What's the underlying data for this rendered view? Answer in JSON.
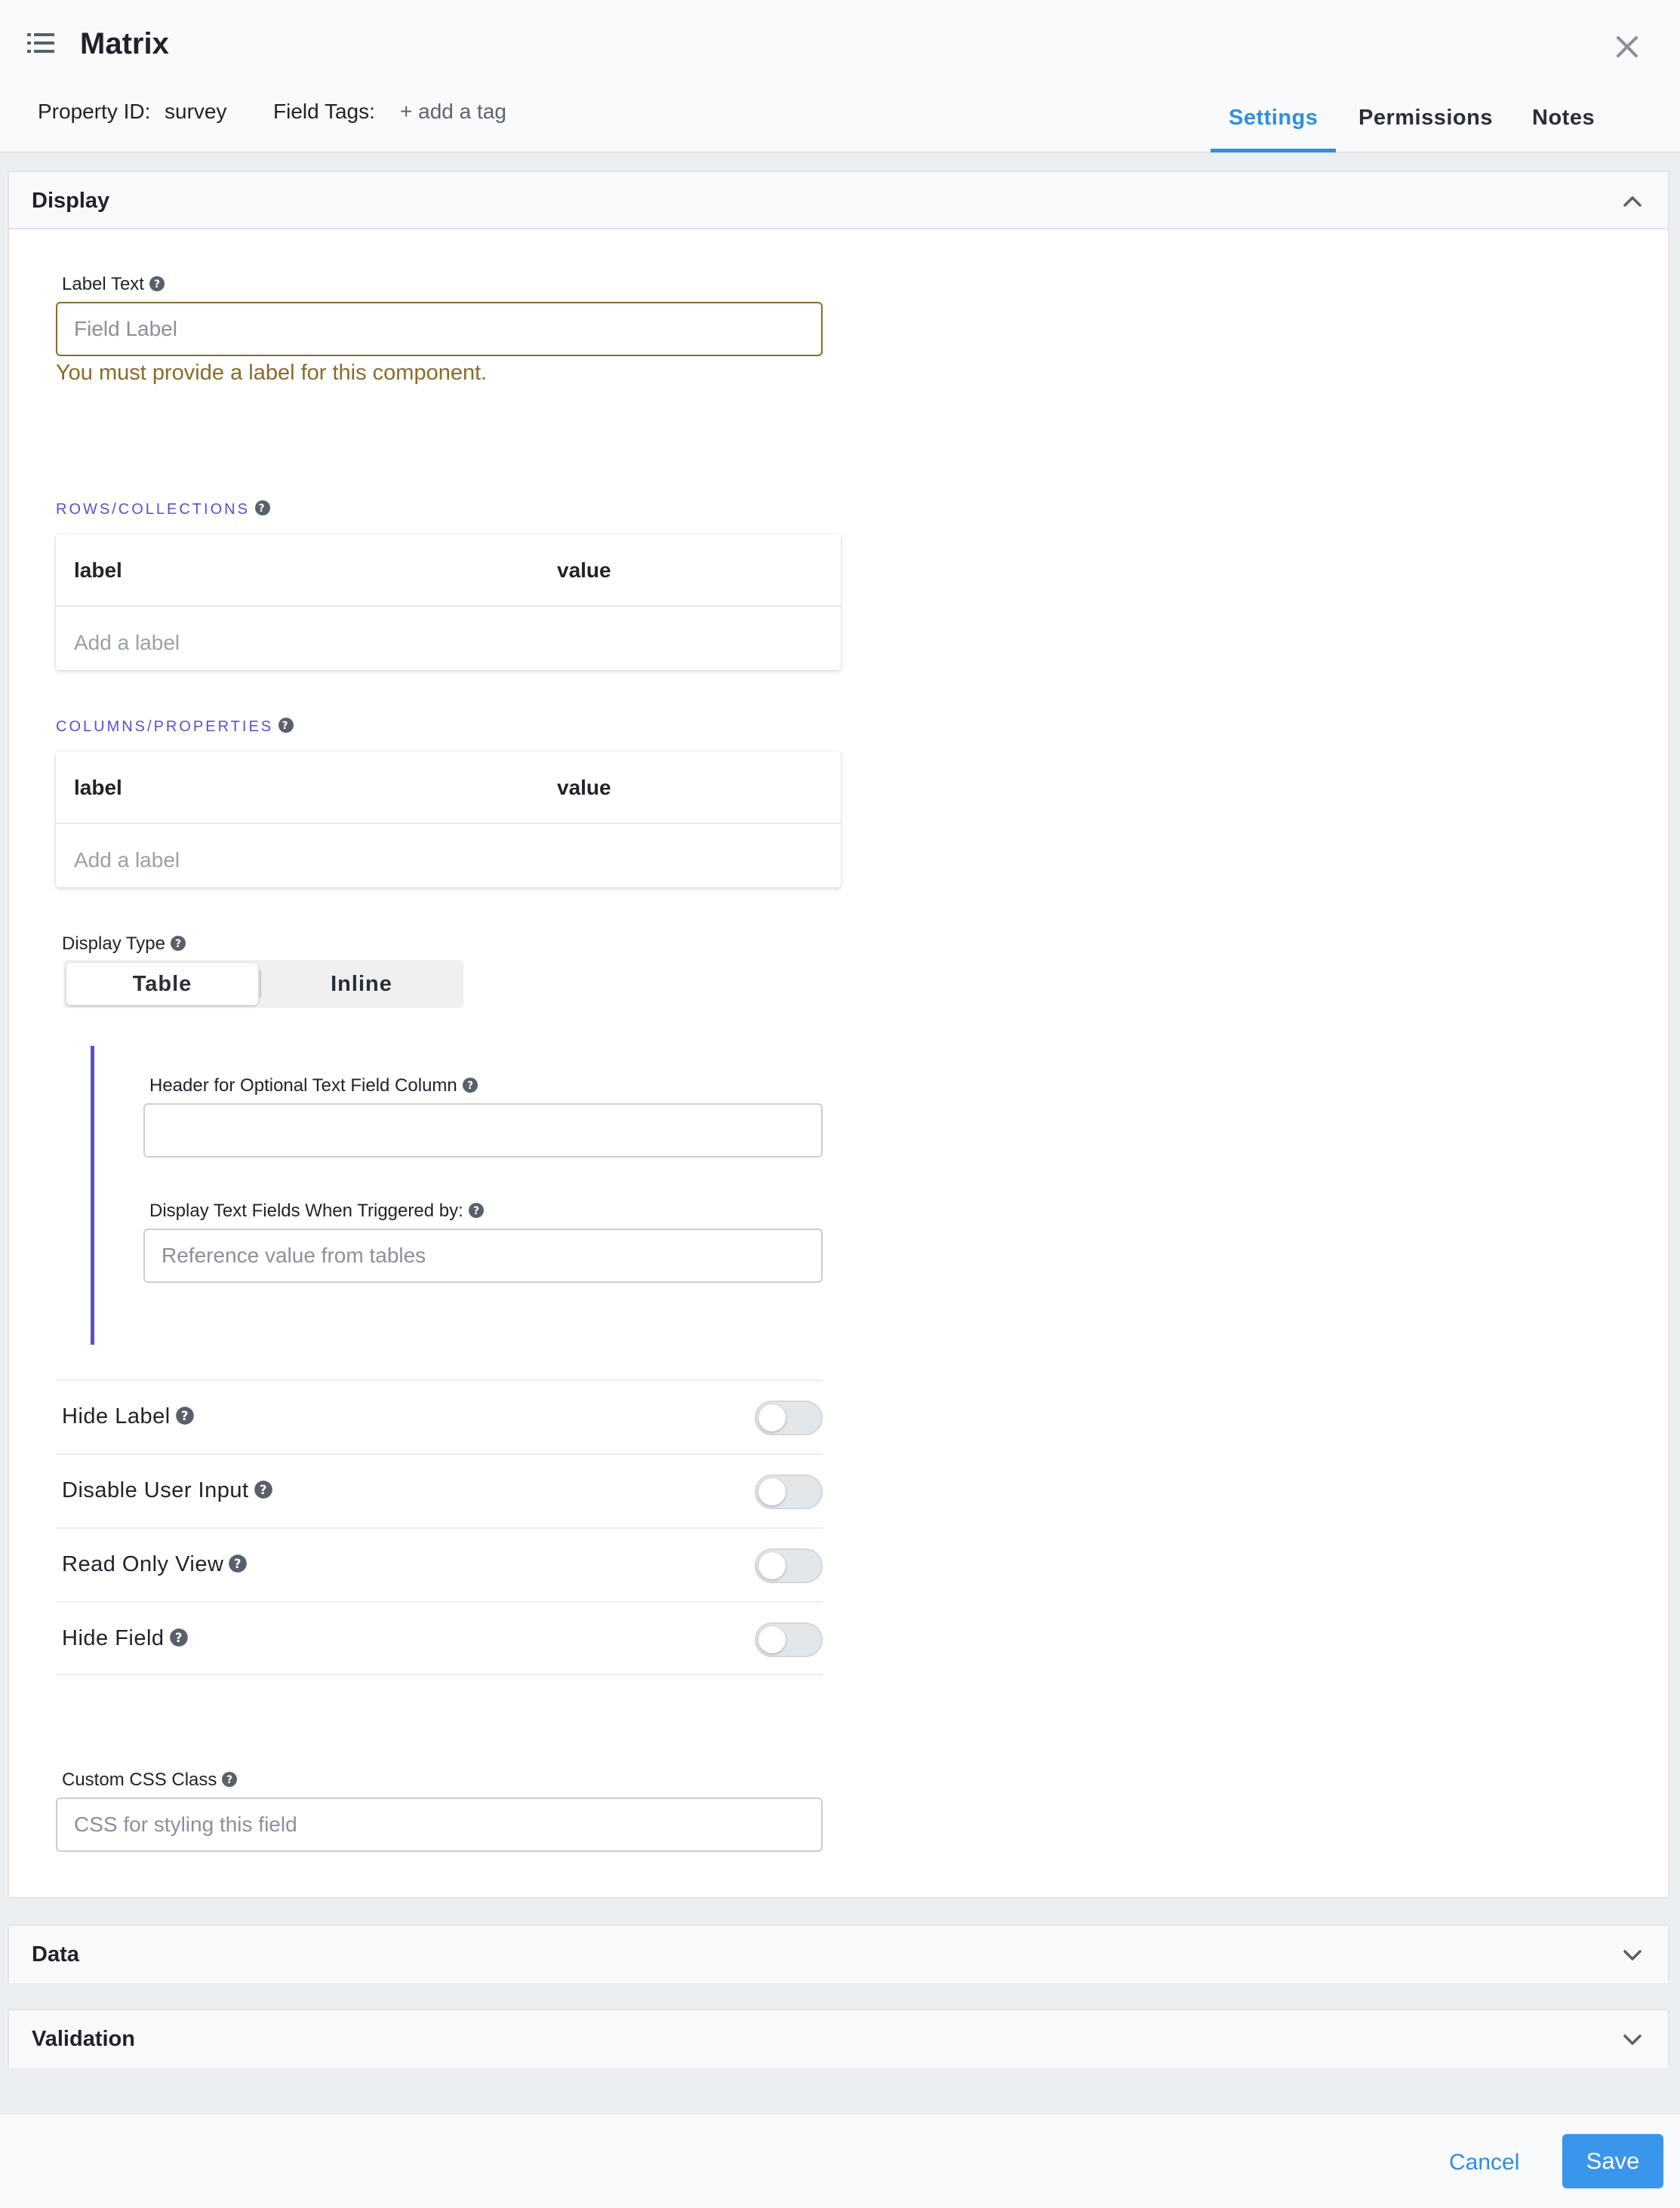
{
  "header": {
    "title": "Matrix",
    "property_id_label": "Property ID:",
    "property_id_value": "survey",
    "field_tags_label": "Field Tags:",
    "add_tag": "+ add a tag",
    "tabs": [
      {
        "label": "Settings",
        "active": true
      },
      {
        "label": "Permissions",
        "active": false
      },
      {
        "label": "Notes",
        "active": false
      }
    ]
  },
  "display": {
    "title": "Display",
    "label_text": {
      "label": "Label Text",
      "value": "",
      "placeholder": "Field Label",
      "error": "You must provide a label for this component."
    },
    "rows": {
      "title": "ROWS/COLLECTIONS",
      "columns": [
        "label",
        "value"
      ],
      "add_placeholder": "Add a label"
    },
    "columns": {
      "title": "COLUMNS/PROPERTIES",
      "columns": [
        "label",
        "value"
      ],
      "add_placeholder": "Add a label"
    },
    "display_type": {
      "label": "Display Type",
      "options": [
        "Table",
        "Inline"
      ],
      "selected": "Table"
    },
    "optional_header": {
      "label": "Header for Optional Text Field Column",
      "value": "",
      "placeholder": ""
    },
    "trigger": {
      "label": "Display Text Fields When Triggered by:",
      "value": "",
      "placeholder": "Reference value from tables"
    },
    "toggles": [
      {
        "label": "Hide Label",
        "on": false
      },
      {
        "label": "Disable User Input",
        "on": false
      },
      {
        "label": "Read Only View",
        "on": false
      },
      {
        "label": "Hide Field",
        "on": false
      }
    ],
    "css_class": {
      "label": "Custom CSS Class",
      "value": "",
      "placeholder": "CSS for styling this field"
    }
  },
  "data_panel": {
    "title": "Data"
  },
  "validation_panel": {
    "title": "Validation"
  },
  "footer": {
    "cancel": "Cancel",
    "save": "Save"
  },
  "colors": {
    "accent": "#2f8ee0",
    "section_title": "#5a4fcf",
    "error": "#8a6b2a",
    "save_button": "#3a96ea"
  },
  "icons": {
    "menu": "list-icon",
    "close": "close-icon",
    "help": "help-circle-icon",
    "collapse": "chevron-up-icon",
    "expand": "chevron-down-icon"
  }
}
